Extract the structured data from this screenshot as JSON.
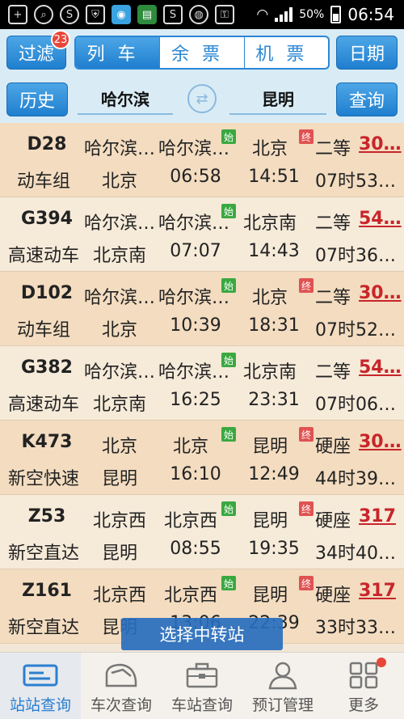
{
  "status_bar": {
    "battery": "50%",
    "time": "06:54",
    "icons": [
      "plus-icon",
      "search-icon",
      "s-icon",
      "shield-icon",
      "eye-icon",
      "app-icon",
      "s-app-icon",
      "chrome-icon",
      "lock-shield-icon",
      "wifi-icon",
      "signal-icon",
      "battery-icon"
    ]
  },
  "header": {
    "filter_label": "过滤",
    "filter_badge": "23",
    "tabs": [
      {
        "label": "列车",
        "active": true
      },
      {
        "label": "余票",
        "active": false
      },
      {
        "label": "机票",
        "active": false
      }
    ],
    "date_label": "日期",
    "history_label": "历史",
    "from_city": "哈尔滨",
    "to_city": "昆明",
    "query_label": "查询"
  },
  "trains": [
    {
      "no": "D28",
      "type": "动车组",
      "from": "哈尔滨…",
      "from_station": "哈尔滨…",
      "to": "北京",
      "start": "始",
      "end": "终",
      "seat": "二等",
      "price": "30…",
      "board_station": "北京",
      "depart": "06:58",
      "arrive": "14:51",
      "duration": "07时53…"
    },
    {
      "no": "G394",
      "type": "高速动车",
      "from": "哈尔滨…",
      "from_station": "哈尔滨…",
      "to": "北京南",
      "start": "始",
      "end": "",
      "seat": "二等",
      "price": "54…",
      "board_station": "北京南",
      "depart": "07:07",
      "arrive": "14:43",
      "duration": "07时36…"
    },
    {
      "no": "D102",
      "type": "动车组",
      "from": "哈尔滨…",
      "from_station": "哈尔滨…",
      "to": "北京",
      "start": "始",
      "end": "终",
      "seat": "二等",
      "price": "30…",
      "board_station": "北京",
      "depart": "10:39",
      "arrive": "18:31",
      "duration": "07时52…"
    },
    {
      "no": "G382",
      "type": "高速动车",
      "from": "哈尔滨…",
      "from_station": "哈尔滨…",
      "to": "北京南",
      "start": "始",
      "end": "",
      "seat": "二等",
      "price": "54…",
      "board_station": "北京南",
      "depart": "16:25",
      "arrive": "23:31",
      "duration": "07时06…"
    },
    {
      "no": "K473",
      "type": "新空快速",
      "from": "北京",
      "from_station": "北京",
      "to": "昆明",
      "start": "始",
      "end": "终",
      "seat": "硬座",
      "price": "30…",
      "board_station": "昆明",
      "depart": "16:10",
      "arrive": "12:49",
      "duration": "44时39…"
    },
    {
      "no": "Z53",
      "type": "新空直达",
      "from": "北京西",
      "from_station": "北京西",
      "to": "昆明",
      "start": "始",
      "end": "终",
      "seat": "硬座",
      "price": "317",
      "board_station": "昆明",
      "depart": "08:55",
      "arrive": "19:35",
      "duration": "34时40…"
    },
    {
      "no": "Z161",
      "type": "新空直达",
      "from": "北京西",
      "from_station": "北京西",
      "to": "昆明",
      "start": "始",
      "end": "终",
      "seat": "硬座",
      "price": "317",
      "board_station": "昆明",
      "depart": "13:06",
      "arrive": "22:39",
      "duration": "33时33…"
    }
  ],
  "transfer_button": "选择中转站",
  "bottom_nav": [
    {
      "label": "站站查询",
      "icon": "ticket-icon",
      "active": true
    },
    {
      "label": "车次查询",
      "icon": "train-icon",
      "active": false
    },
    {
      "label": "车站查询",
      "icon": "briefcase-icon",
      "active": false
    },
    {
      "label": "预订管理",
      "icon": "person-icon",
      "active": false
    },
    {
      "label": "更多",
      "icon": "grid-icon",
      "active": false
    }
  ]
}
